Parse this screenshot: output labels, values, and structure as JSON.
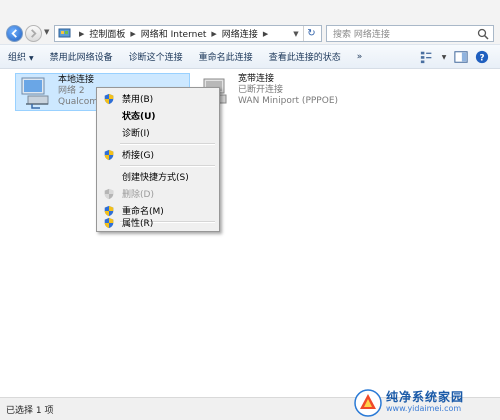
{
  "address_bar": {
    "crumbs": [
      "控制面板",
      "网络和 Internet",
      "网络连接"
    ],
    "search_placeholder": "搜索 网络连接"
  },
  "toolbar": {
    "organize": "组织",
    "disable_device": "禁用此网络设备",
    "diagnose": "诊断这个连接",
    "rename": "重命名此连接",
    "view_status": "查看此连接的状态",
    "more": "»"
  },
  "connections": [
    {
      "name": "本地连接",
      "status": "网络 2",
      "device": "Qualcomm"
    },
    {
      "name": "宽带连接",
      "status": "已断开连接",
      "device": "WAN Miniport (PPPOE)"
    }
  ],
  "context_menu": {
    "items": [
      {
        "label": "禁用(B)",
        "icon": "shield-icon"
      },
      {
        "label": "状态(U)",
        "bold": true
      },
      {
        "label": "诊断(I)"
      },
      {
        "label": "桥接(G)",
        "icon": "shield-icon"
      },
      {
        "label": "创建快捷方式(S)"
      },
      {
        "label": "删除(D)",
        "icon": "shield-icon",
        "disabled": true
      },
      {
        "label": "重命名(M)",
        "icon": "shield-icon"
      },
      {
        "label": "属性(R)",
        "icon": "shield-icon"
      }
    ]
  },
  "status_bar": {
    "text": "已选择 1 项"
  },
  "watermark": {
    "title": "纯净系统家园",
    "url": "www.yidaimei.com"
  },
  "colors": {
    "accent": "#1f5fbf",
    "selection": "#cde8ff",
    "menu_bg": "#f0f0f0"
  }
}
